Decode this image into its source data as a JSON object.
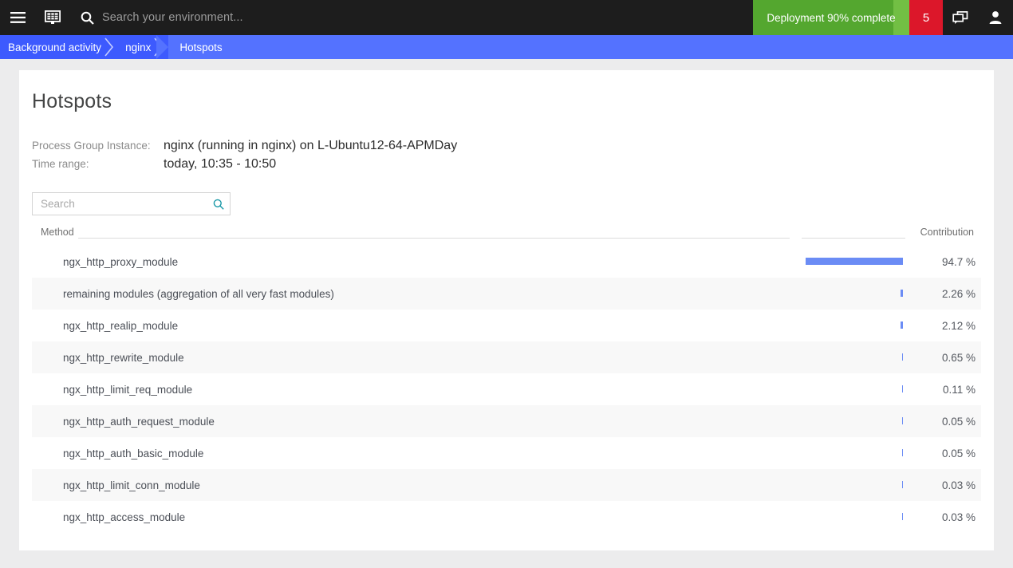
{
  "topbar": {
    "menu_icon": "hamburger-menu-icon",
    "dashboard_icon": "dashboard-grid-icon",
    "search_icon": "search-icon",
    "search_placeholder": "Search your environment...",
    "deployment": {
      "label": "Deployment 90% complete",
      "progress_percent": 90,
      "color_fill": "#54a72f",
      "color_track": "#72bf44"
    },
    "alerts": {
      "count": "5",
      "color": "#dc172a"
    },
    "chat_icon": "chat-bubbles-icon",
    "user_icon": "user-avatar-icon"
  },
  "breadcrumb": {
    "items": [
      {
        "label": "Background activity",
        "active": false
      },
      {
        "label": "nginx",
        "active": false
      },
      {
        "label": "Hotspots",
        "active": true
      }
    ],
    "color": "#3d5afe",
    "active_color": "#5472ff"
  },
  "page": {
    "title": "Hotspots",
    "meta": [
      {
        "label": "Process Group Instance:",
        "value": "nginx (running in nginx) on L-Ubuntu12-64-APMDay"
      },
      {
        "label": "Time range:",
        "value": "today, 10:35 - 10:50"
      }
    ],
    "search": {
      "placeholder": "Search",
      "value": "",
      "icon": "search-icon"
    }
  },
  "table": {
    "columns": {
      "method": "Method",
      "contribution": "Contribution"
    },
    "bar_color": "#6b8cf5",
    "rows": [
      {
        "method": "ngx_http_proxy_module",
        "pct": "94.7 %",
        "value": 94.7
      },
      {
        "method": "remaining modules (aggregation of all very fast modules)",
        "pct": "2.26 %",
        "value": 2.26
      },
      {
        "method": "ngx_http_realip_module",
        "pct": "2.12 %",
        "value": 2.12
      },
      {
        "method": "ngx_http_rewrite_module",
        "pct": "0.65 %",
        "value": 0.65
      },
      {
        "method": "ngx_http_limit_req_module",
        "pct": "0.11 %",
        "value": 0.11
      },
      {
        "method": "ngx_http_auth_request_module",
        "pct": "0.05 %",
        "value": 0.05
      },
      {
        "method": "ngx_http_auth_basic_module",
        "pct": "0.05 %",
        "value": 0.05
      },
      {
        "method": "ngx_http_limit_conn_module",
        "pct": "0.03 %",
        "value": 0.03
      },
      {
        "method": "ngx_http_access_module",
        "pct": "0.03 %",
        "value": 0.03
      }
    ]
  }
}
